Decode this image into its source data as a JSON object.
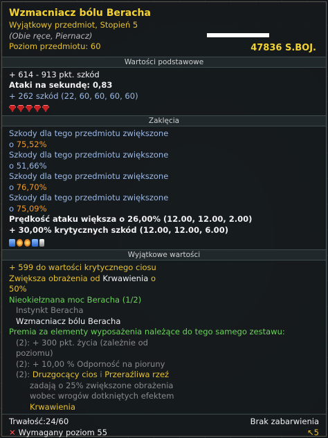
{
  "item": {
    "name": "Wzmacniacz bólu Beracha",
    "rarity_line": "Wyjątkowy przedmiot, Stopień 5",
    "type_line": "(Obie ręce, Piernacz)",
    "level_line": "Poziom przedmiotu: 60",
    "price": "47836 S.BOJ."
  },
  "sections": {
    "base": "Wartości podstawowe",
    "enchant": "Zaklęcia",
    "unique": "Wyjątkowe wartości"
  },
  "base_stats": [
    "+ 614 - 913 pkt. szkód",
    "Ataki na sekundę: 0,83",
    "+ 262 szkód (22, 60, 60, 60, 60)"
  ],
  "enchant_lines": [
    {
      "text": "Szkody dla tego przedmiotu zwiększone",
      "value_prefix": "o ",
      "value": "75,52%"
    },
    {
      "text": "Szkody dla tego przedmiotu zwiększone",
      "value_prefix": "o ",
      "value": "51,66%"
    },
    {
      "text": "Szkody dla tego przedmiotu zwiększone",
      "value_prefix": "o ",
      "value": "76,70%"
    },
    {
      "text": "Szkody dla tego przedmiotu zwiększone",
      "value_prefix": "o ",
      "value": "75,09%"
    }
  ],
  "enchant_extra": [
    "Prędkość ataku większa o 26,00% (12.00, 12.00, 2.00)",
    "+ 30,00% krytycznych szkód (12.00, 12.00, 6.00)"
  ],
  "unique": {
    "crit": "+ 599 do wartości krytycznego ciosu",
    "bleed_a": "Zwiększa obrażenia od ",
    "bleed_b": "Krwawienia",
    "bleed_c": " o",
    "bleed_pct": "50%",
    "set_name": "Nieokiełznana moc Beracha (1/2)",
    "set_item_1": "Instynkt Beracha",
    "set_item_2": "Wzmacniacz bólu Beracha",
    "set_bonus_header": "Premia za elementy wyposażenia należące do tego samego zestawu:",
    "bonus_2a_1": "(2): + 300 pkt. życia (zależnie od",
    "bonus_2a_2": "poziomu)",
    "bonus_2b": "(2): + 10,00 % Odporność na pioruny",
    "bonus_2c_prefix": "(2): ",
    "bonus_2c_a": "Druzgocący cios",
    "bonus_2c_sep": " i ",
    "bonus_2c_b": "Przeraźliwa rzeź",
    "bonus_2c_l2": "zadają o 25% zwiększone obrażenia",
    "bonus_2c_l3": "wobec wrogów dotkniętych efektem",
    "bonus_2c_l4": "Krwawienia"
  },
  "footer": {
    "durability": "Trwałość:24/60",
    "dye": "Brak zabarwienia",
    "required": "Wymagany poziom 55",
    "req_icon": "✕",
    "cursor_label": "5"
  }
}
